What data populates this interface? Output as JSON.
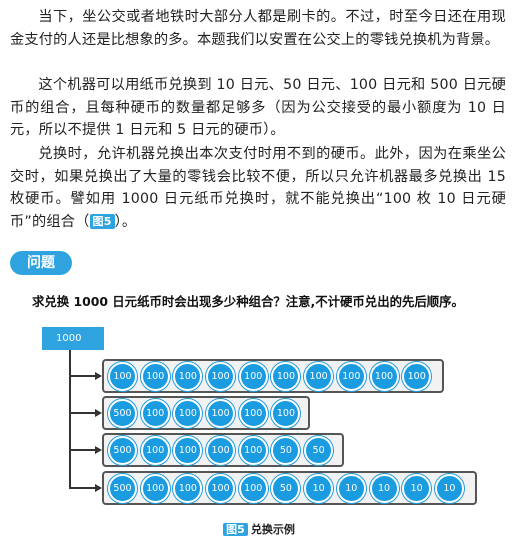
{
  "paragraphs": [
    {
      "text": "当下，坐公交或者地铁时大部分人都是刷卡的。不过，时至今日还在用现金支付的人还是比想象的多。本题我们以安置在公交上的零钱兑换机为背景。"
    },
    {
      "text": "这个机器可以用纸币兑换到 10 日元、50 日元、100 日元和 500 日元硬币的组合，且每种硬币的数量都足够多（因为公交接受的最小额度为 10 日元，所以不提供 1 日元和 5 日元的硬币）。"
    },
    {
      "text_before": "兑换时，允许机器兑换出本次支付时用不到的硬币。此外，因为在乘坐公交时，如果兑换出了大量的零钱会比较不便，所以只允许机器最多兑换出 15 枚硬币。譬如用 1000 日元纸币兑换时，就不能兑换出“100 枚 10 日元硬币”的组合（",
      "figure_ref": "图5",
      "text_after": "）。"
    }
  ],
  "question_label": "问题",
  "question": "求兑换 1000 日元纸币时会出现多少种组合？注意,不计硬币兑出的先后顺序。",
  "figure": {
    "root_label": "1000",
    "rows": [
      {
        "coins": [
          "100",
          "100",
          "100",
          "100",
          "100",
          "100",
          "100",
          "100",
          "100",
          "100"
        ]
      },
      {
        "coins": [
          "500",
          "100",
          "100",
          "100",
          "100",
          "100"
        ]
      },
      {
        "coins": [
          "500",
          "100",
          "100",
          "100",
          "100",
          "50",
          "50"
        ]
      },
      {
        "coins": [
          "500",
          "100",
          "100",
          "100",
          "100",
          "50",
          "10",
          "10",
          "10",
          "10",
          "10"
        ]
      }
    ],
    "caption_tag": "图5",
    "caption_text": "兑换示例"
  },
  "colors": {
    "accent": "#2fa3e0",
    "coin": "#1b9be0",
    "row_bg": "#f2f2f2"
  }
}
